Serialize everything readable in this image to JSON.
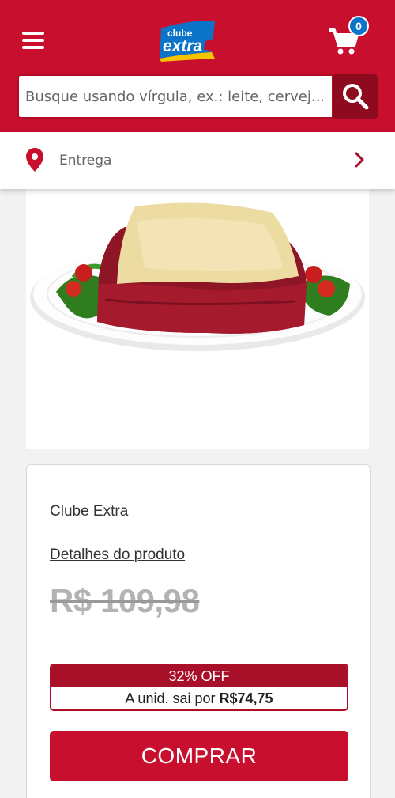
{
  "header": {
    "logo_top": "clube",
    "logo_bottom": "extra",
    "cart_count": "0"
  },
  "search": {
    "placeholder": "Busque usando vírgula, ex.: leite, cervej..."
  },
  "delivery": {
    "label": "Entrega"
  },
  "product": {
    "seller": "Clube Extra",
    "details_link": "Detalhes do produto",
    "old_price": "R$ 109,98",
    "discount_label": "32% OFF",
    "unit_price_prefix": "A unid. sai por",
    "unit_price": "R$74,75",
    "buy_label": "COMPRAR"
  },
  "colors": {
    "brand_red": "#c8102e",
    "dark_red": "#8e0a1f",
    "badge_blue": "#0b73c8"
  }
}
